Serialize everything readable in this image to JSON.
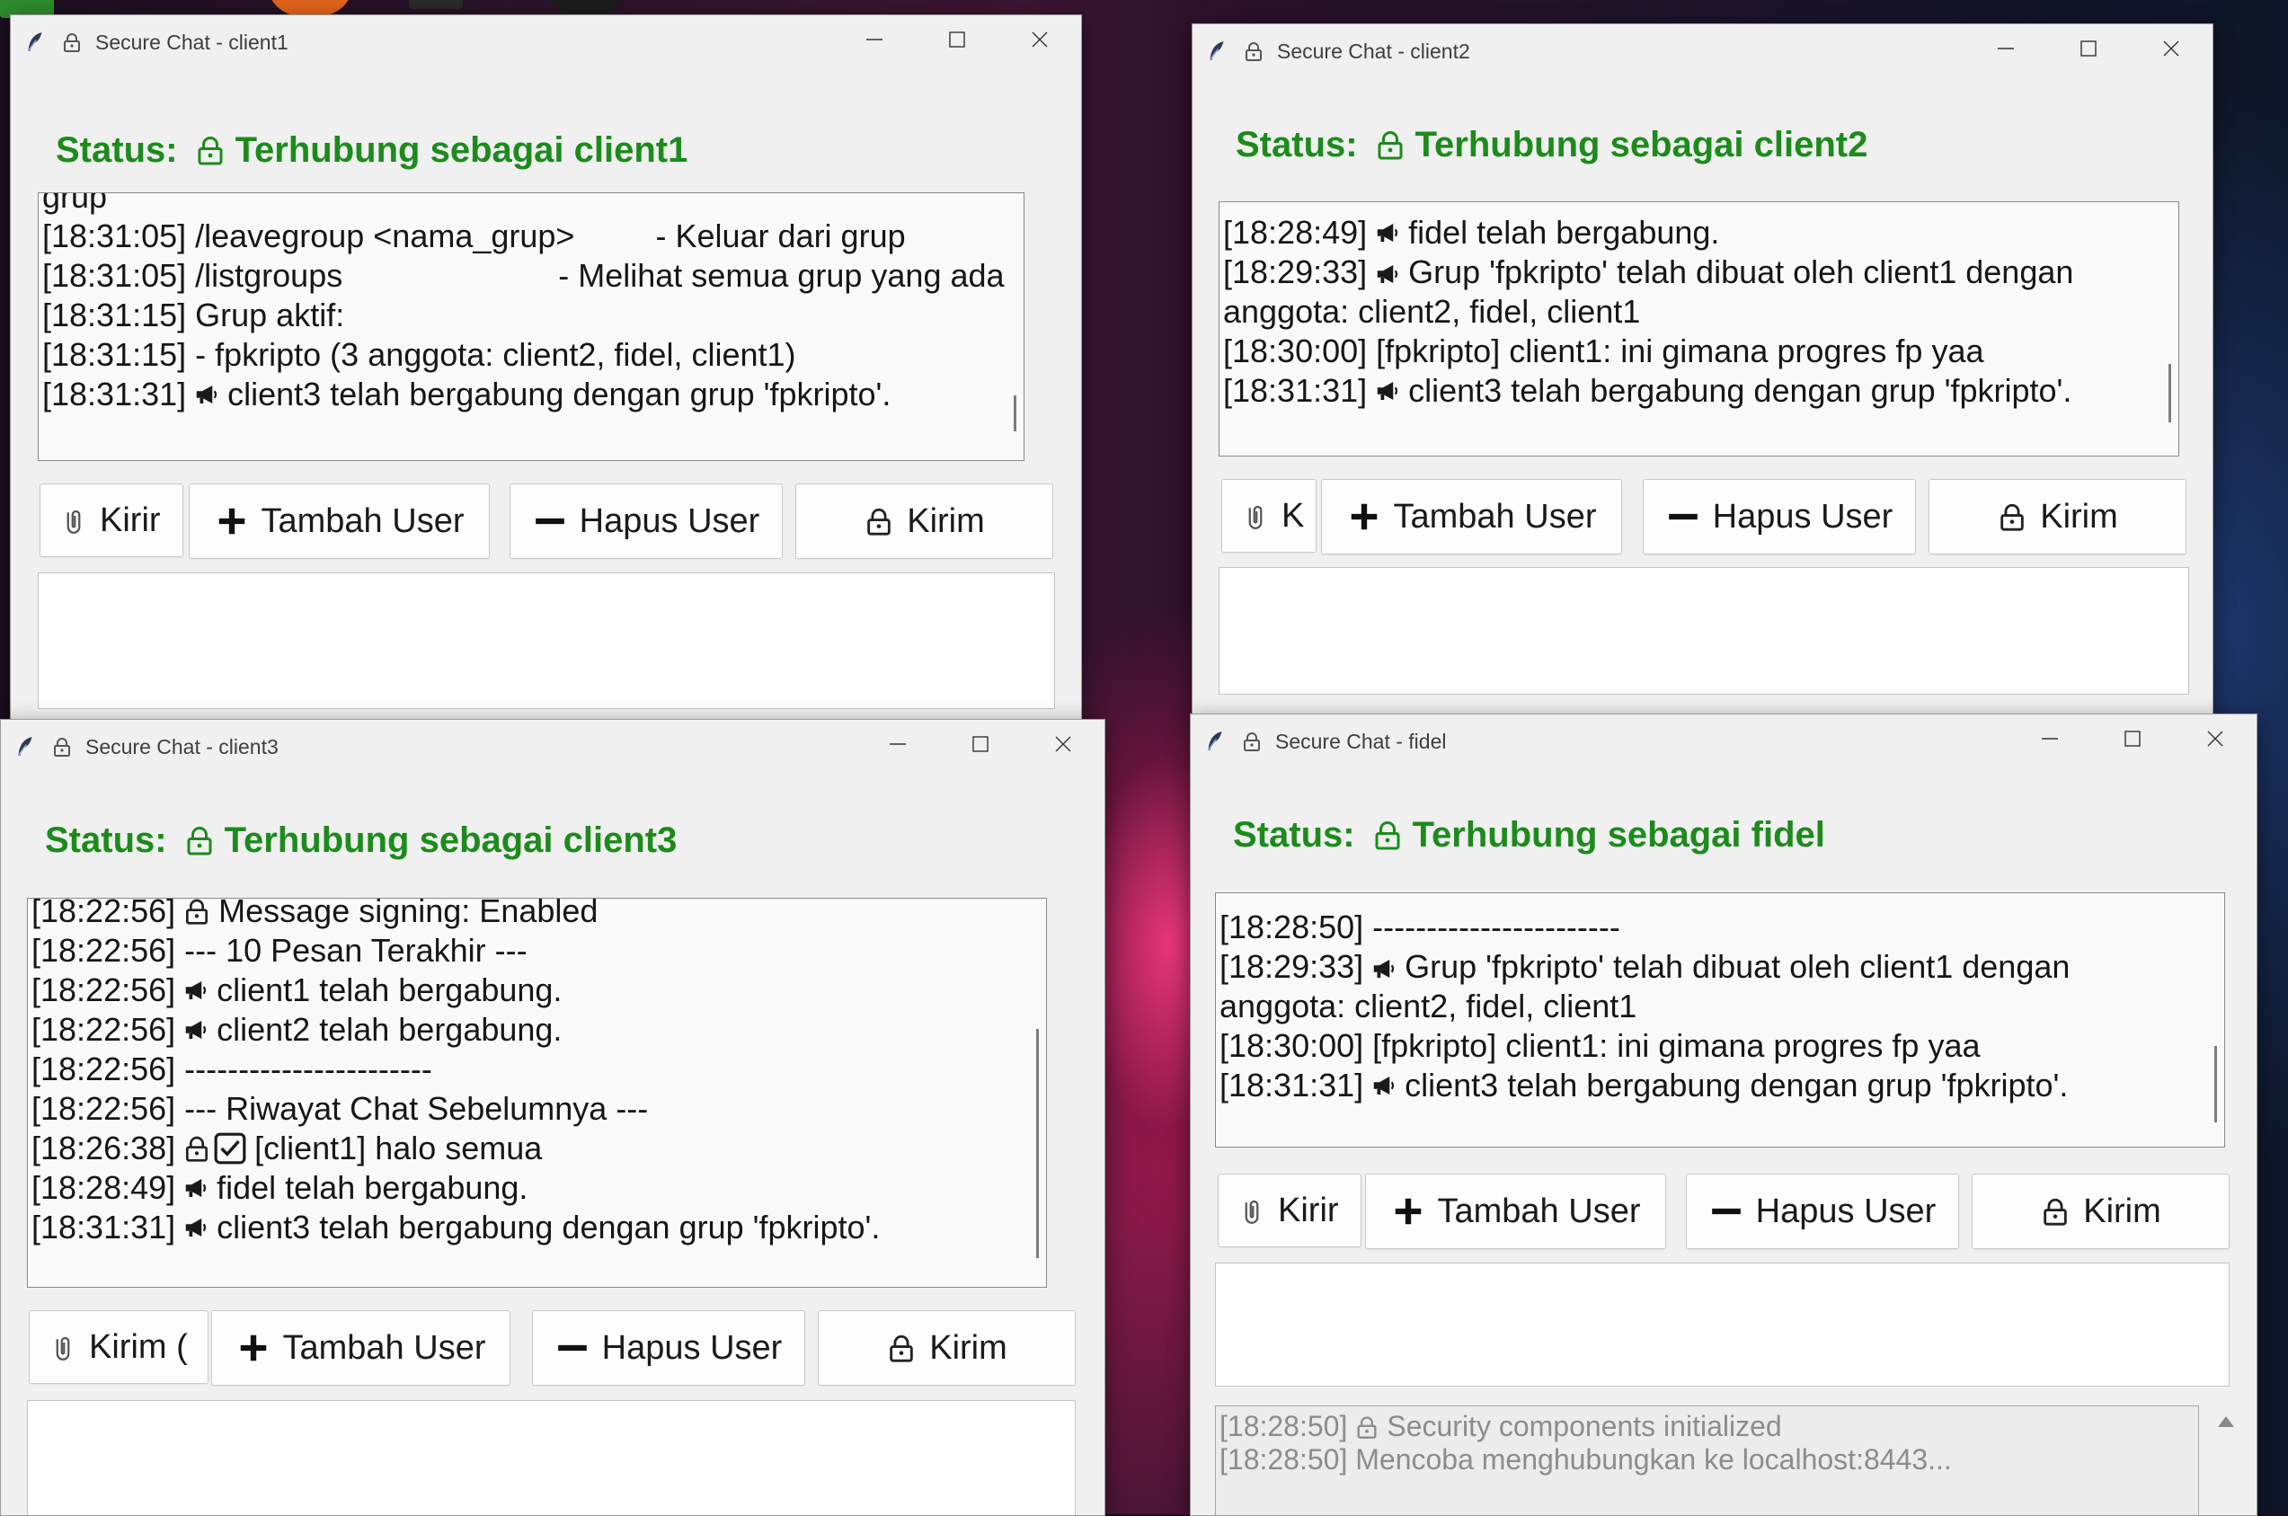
{
  "windows": {
    "client1": {
      "title": "Secure Chat - client1",
      "status_label": "Status:",
      "status_text": "Terhubung sebagai client1",
      "log": [
        "grup",
        "[18:31:05] /leavegroup <nama_grup>         - Keluar dari grup",
        "[18:31:05] /listgroups                        - Melihat semua grup yang ada",
        "[18:31:15] Grup aktif:",
        "[18:31:15] - fpkripto (3 anggota: client2, fidel, client1)",
        "[18:31:31]",
        "client3 telah bergabung dengan grup 'fpkripto'."
      ],
      "buttons": [
        "Kirir",
        "Tambah User",
        "Hapus User",
        "Kirim"
      ]
    },
    "client2": {
      "title": "Secure Chat - client2",
      "status_label": "Status:",
      "status_text": "Terhubung sebagai client2",
      "log": [
        "[18:28:49]",
        "fidel telah bergabung.",
        "[18:29:33]",
        "Grup 'fpkripto' telah dibuat oleh client1 dengan anggota: client2, fidel, client1",
        "[18:30:00] [fpkripto] client1: ini gimana progres fp yaa",
        "[18:31:31]",
        "client3 telah bergabung dengan grup 'fpkripto'."
      ],
      "buttons": [
        "K",
        "Tambah User",
        "Hapus User",
        "Kirim"
      ]
    },
    "client3": {
      "title": "Secure Chat - client3",
      "status_label": "Status:",
      "status_text": "Terhubung sebagai client3",
      "log": [
        "[18:22:56]",
        "Message signing: Enabled",
        "[18:22:56] --- 10 Pesan Terakhir ---",
        "[18:22:56]",
        "client1 telah bergabung.",
        "[18:22:56]",
        "client2 telah bergabung.",
        "[18:22:56] -----------------------",
        "[18:22:56] --- Riwayat Chat Sebelumnya ---",
        "[18:26:38]",
        "[client1] halo semua",
        "[18:28:49]",
        "fidel telah bergabung.",
        "[18:31:31]",
        "client3 telah bergabung dengan grup 'fpkripto'."
      ],
      "buttons": [
        "Kirim (",
        "Tambah User",
        "Hapus User",
        "Kirim"
      ]
    },
    "fidel": {
      "title": "Secure Chat - fidel",
      "status_label": "Status:",
      "status_text": "Terhubung sebagai fidel",
      "log": [
        "[18:28:50] -----------------------",
        "[18:29:33]",
        "Grup 'fpkripto' telah dibuat oleh client1 dengan anggota: client2, fidel, client1",
        "[18:30:00] [fpkripto] client1: ini gimana progres fp yaa",
        "[18:31:31]",
        "client3 telah bergabung dengan grup 'fpkripto'."
      ],
      "buttons": [
        "Kirir",
        "Tambah User",
        "Hapus User",
        "Kirim"
      ],
      "system_log": [
        "[18:28:50]",
        "Security components initialized",
        "[18:28:50] Mencoba menghubungkan ke localhost:8443..."
      ]
    }
  },
  "colors": {
    "status_green": "#1c8b1c",
    "window_bg": "#f0f0f0",
    "title_text": "#3e3e3e",
    "log_text": "#161616",
    "system_log_text": "#8c8c8c"
  },
  "icons": {
    "titlebar": [
      "feather-icon",
      "lock-icon"
    ],
    "status": "lock-icon",
    "log": [
      "megaphone-icon",
      "lock-icon",
      "checkbox-icon"
    ],
    "buttons": [
      "file-icon",
      "plus-icon",
      "minus-icon",
      "lock-icon"
    ],
    "window_controls": [
      "minimize-icon",
      "maximize-icon",
      "close-icon"
    ]
  }
}
